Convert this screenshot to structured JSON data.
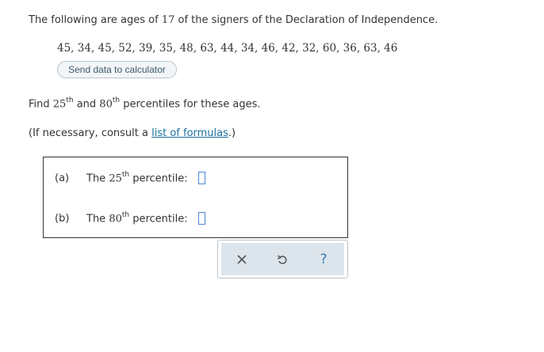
{
  "problem": {
    "intro_prefix": "The following are ages of ",
    "intro_count": "17",
    "intro_suffix": " of the signers of the Declaration of Independence.",
    "data_values": "45, 34, 45, 52, 39, 35, 48, 63, 44, 34, 46, 42, 32, 60, 36, 63, 46",
    "send_button_label": "Send data to calculator",
    "question_prefix": "Find ",
    "question_p1_num": "25",
    "question_p1_sup": "th",
    "question_mid": " and ",
    "question_p2_num": "80",
    "question_p2_sup": "th",
    "question_suffix": " percentiles for these ages.",
    "note_prefix": "(If necessary, consult a ",
    "note_link": "list of formulas",
    "note_suffix": ".)"
  },
  "answers": [
    {
      "part": "(a)",
      "prefix": "The ",
      "num": "25",
      "sup": "th",
      "suffix": " percentile:"
    },
    {
      "part": "(b)",
      "prefix": "The ",
      "num": "80",
      "sup": "th",
      "suffix": " percentile:"
    }
  ],
  "toolbar": {
    "icons": [
      "close-icon",
      "undo-icon",
      "help-icon"
    ],
    "help_glyph": "?",
    "close_color": "#555555",
    "undo_color": "#555555",
    "help_color": "#3d7ab8"
  }
}
